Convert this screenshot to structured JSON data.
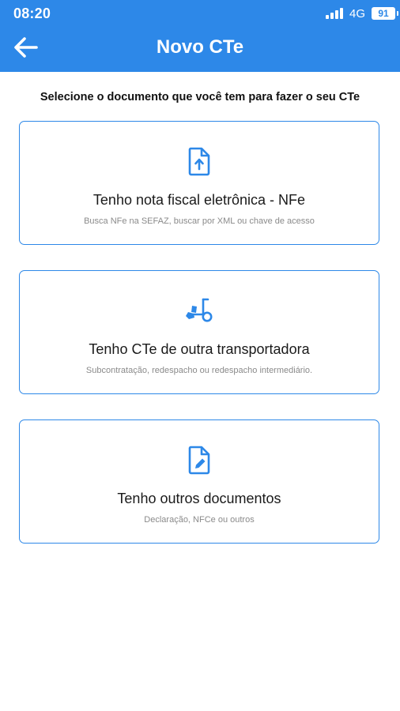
{
  "status_bar": {
    "time": "08:20",
    "network": "4G",
    "battery": "91"
  },
  "header": {
    "title": "Novo CTe"
  },
  "instruction": "Selecione o documento que você tem para fazer o seu CTe",
  "options": [
    {
      "icon": "file-upload-icon",
      "title": "Tenho nota fiscal eletrônica - NFe",
      "subtitle": "Busca NFe na SEFAZ, buscar por XML ou chave de acesso"
    },
    {
      "icon": "hand-truck-icon",
      "title": "Tenho CTe de outra transportadora",
      "subtitle": "Subcontratação, redespacho ou redespacho intermediário."
    },
    {
      "icon": "file-edit-icon",
      "title": "Tenho outros documentos",
      "subtitle": "Declaração, NFCe ou outros"
    }
  ],
  "colors": {
    "primary": "#2d88e8",
    "subtitle": "#8a8a8a"
  }
}
